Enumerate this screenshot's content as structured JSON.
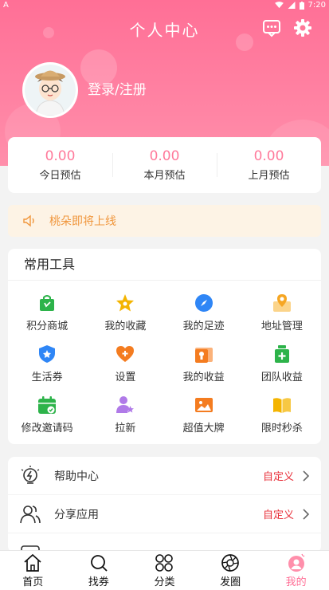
{
  "statusbar": {
    "left": "A",
    "time": "7:20"
  },
  "header": {
    "title": "个人中心",
    "login": "登录/注册"
  },
  "stats": [
    {
      "value": "0.00",
      "label": "今日预估"
    },
    {
      "value": "0.00",
      "label": "本月预估"
    },
    {
      "value": "0.00",
      "label": "上月预估"
    }
  ],
  "notice": {
    "text": "桃朵即将上线"
  },
  "tools": {
    "title": "常用工具",
    "items": [
      {
        "label": "积分商城",
        "icon": "shopping-bag-icon",
        "color": "#2db34a"
      },
      {
        "label": "我的收藏",
        "icon": "star-icon",
        "color": "#f4b400"
      },
      {
        "label": "我的足迹",
        "icon": "compass-icon",
        "color": "#2f86f6"
      },
      {
        "label": "地址管理",
        "icon": "map-pin-icon",
        "color": "#f6b94a"
      },
      {
        "label": "生活券",
        "icon": "shield-star-icon",
        "color": "#2f86f6"
      },
      {
        "label": "设置",
        "icon": "heart-plus-icon",
        "color": "#f47c20"
      },
      {
        "label": "我的收益",
        "icon": "wallet-icon",
        "color": "#f47c20"
      },
      {
        "label": "团队收益",
        "icon": "medicine-bottle-icon",
        "color": "#2db34a"
      },
      {
        "label": "修改邀请码",
        "icon": "calendar-check-icon",
        "color": "#2db34a"
      },
      {
        "label": "拉新",
        "icon": "user-star-icon",
        "color": "#b07ae8"
      },
      {
        "label": "超值大牌",
        "icon": "picture-icon",
        "color": "#f47c20"
      },
      {
        "label": "限时秒杀",
        "icon": "book-icon",
        "color": "#f4b400"
      }
    ]
  },
  "menu": [
    {
      "label": "帮助中心",
      "tag": "自定义",
      "icon": "lightbulb-icon"
    },
    {
      "label": "分享应用",
      "tag": "自定义",
      "icon": "users-icon"
    }
  ],
  "tabbar": [
    {
      "label": "首页",
      "icon": "home-icon"
    },
    {
      "label": "找券",
      "icon": "search-icon"
    },
    {
      "label": "分类",
      "icon": "category-icon"
    },
    {
      "label": "发圈",
      "icon": "camera-aperture-icon"
    },
    {
      "label": "我的",
      "icon": "profile-icon"
    }
  ],
  "colors": {
    "brand": "#ff6f96",
    "accent": "#f0963c",
    "tag": "#e8303a"
  }
}
